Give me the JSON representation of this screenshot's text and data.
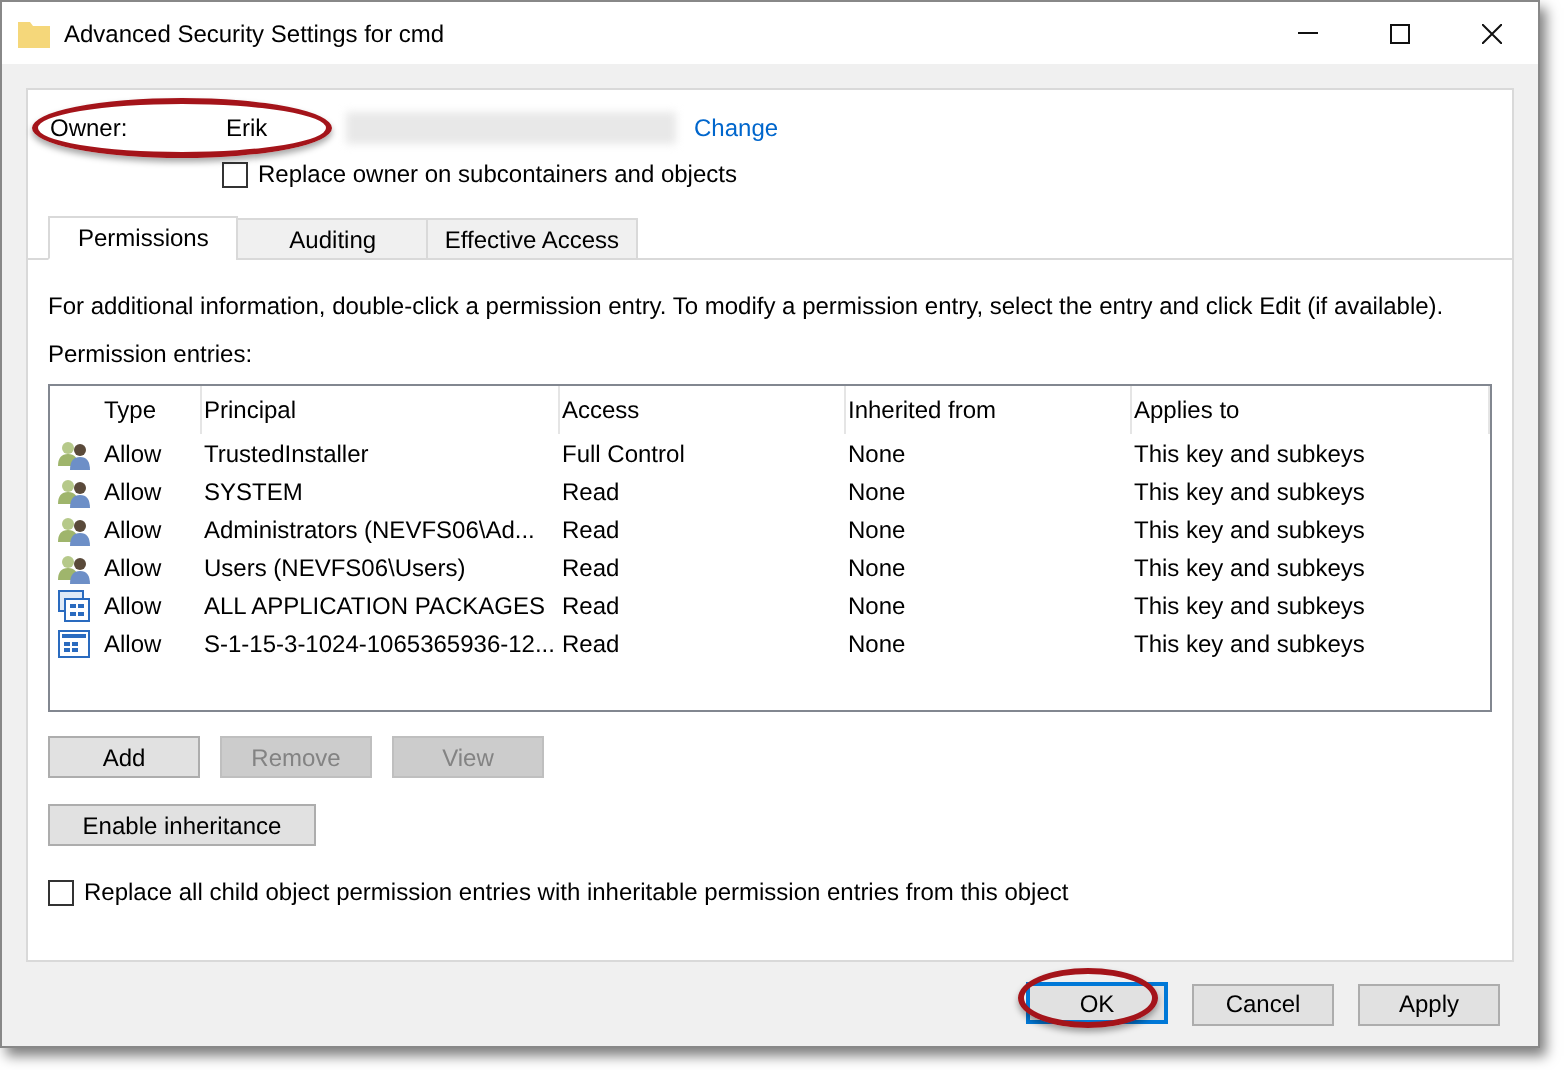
{
  "window": {
    "title": "Advanced Security Settings for cmd"
  },
  "owner": {
    "label": "Owner:",
    "value": "Erik",
    "link": "Change"
  },
  "replace_owner": {
    "label": "Replace owner on subcontainers and objects",
    "checked": false
  },
  "tabs": [
    {
      "label": "Permissions",
      "selected": true
    },
    {
      "label": "Auditing",
      "selected": false
    },
    {
      "label": "Effective Access",
      "selected": false
    }
  ],
  "info": "For additional information, double-click a permission entry. To modify a permission entry, select the entry and click Edit (if available).",
  "entries_label": "Permission entries:",
  "table": {
    "columns": [
      "Type",
      "Principal",
      "Access",
      "Inherited from",
      "Applies to"
    ],
    "rows": [
      {
        "kind": "group",
        "cells": [
          "Allow",
          "TrustedInstaller",
          "Full Control",
          "None",
          "This key and subkeys"
        ]
      },
      {
        "kind": "group",
        "cells": [
          "Allow",
          "SYSTEM",
          "Read",
          "None",
          "This key and subkeys"
        ]
      },
      {
        "kind": "group",
        "cells": [
          "Allow",
          "Administrators (NEVFS06\\Ad...",
          "Read",
          "None",
          "This key and subkeys"
        ]
      },
      {
        "kind": "group",
        "cells": [
          "Allow",
          "Users (NEVFS06\\Users)",
          "Read",
          "None",
          "This key and subkeys"
        ]
      },
      {
        "kind": "package",
        "cells": [
          "Allow",
          "ALL APPLICATION PACKAGES",
          "Read",
          "None",
          "This key and subkeys"
        ]
      },
      {
        "kind": "app",
        "cells": [
          "Allow",
          "S-1-15-3-1024-1065365936-12...",
          "Read",
          "None",
          "This key and subkeys"
        ]
      }
    ]
  },
  "entry_buttons": [
    {
      "label": "Add",
      "disabled": false
    },
    {
      "label": "Remove",
      "disabled": true
    },
    {
      "label": "View",
      "disabled": true
    }
  ],
  "inheritance_button": "Enable inheritance",
  "replace_children": {
    "label": "Replace all child object permission entries with inheritable permission entries from this object",
    "checked": false
  },
  "footer_buttons": [
    {
      "label": "OK",
      "default": true
    },
    {
      "label": "Cancel",
      "default": false
    },
    {
      "label": "Apply",
      "default": false
    }
  ]
}
